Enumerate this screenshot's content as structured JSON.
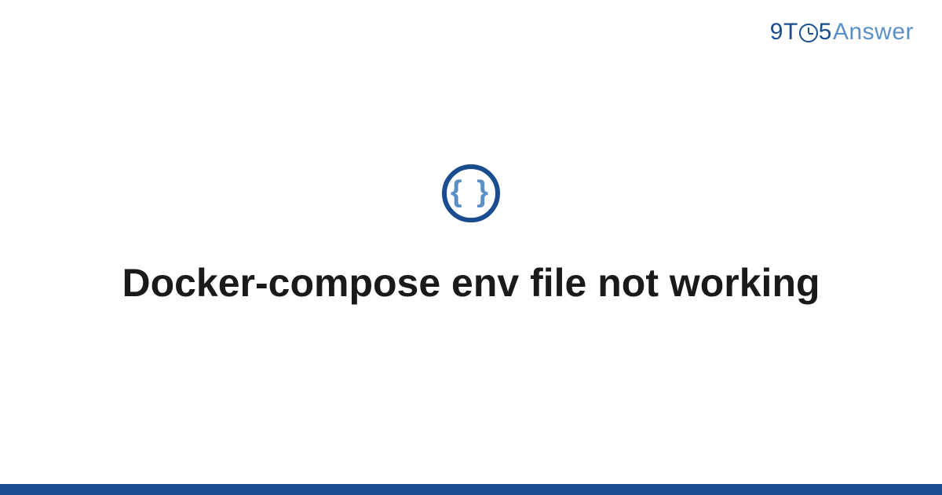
{
  "brand": {
    "nine": "9",
    "t": "T",
    "five": "5",
    "answer": "Answer"
  },
  "icon": {
    "braces": "{ }"
  },
  "title": "Docker-compose env file not working",
  "colors": {
    "primary": "#1a4d8f",
    "accent": "#5b8fc7"
  }
}
